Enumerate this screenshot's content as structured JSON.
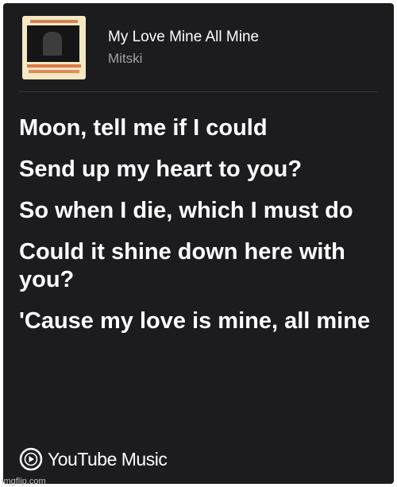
{
  "song": {
    "title": "My Love Mine All Mine",
    "artist": "Mitski"
  },
  "lyrics": [
    "Moon, tell me if I could",
    "Send up my heart to you?",
    "So when I die, which I must do",
    "Could it shine down here with you?",
    "'Cause my love is mine, all mine"
  ],
  "footer": {
    "brand": "YouTube Music",
    "logo_icon": "youtube-music-play-icon"
  },
  "watermark": "imgflip.com",
  "colors": {
    "card_background": "#1c1c1e",
    "lyric_text": "#ffffff",
    "artist_text": "#a3a3a8",
    "divider": "#3a3a3c"
  }
}
